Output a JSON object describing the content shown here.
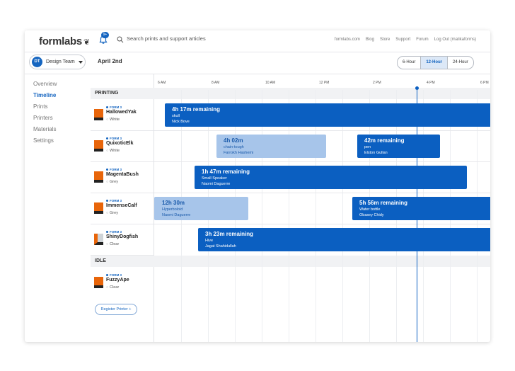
{
  "header": {
    "logo": "formlabs",
    "notification_count": "9+",
    "search_placeholder": "Search prints and support articles",
    "links": [
      "formlabs.com",
      "Blog",
      "Store",
      "Support",
      "Forum",
      "Log Out (malikaforms)"
    ]
  },
  "subbar": {
    "team_initials": "DT",
    "team_name": "Design Team",
    "date": "April 2nd",
    "views": [
      "6-Hour",
      "12-Hour",
      "24-Hour"
    ],
    "active_view": "12-Hour"
  },
  "nav": {
    "items": [
      "Overview",
      "Timeline",
      "Prints",
      "Printers",
      "Materials",
      "Settings"
    ],
    "active": "Timeline"
  },
  "sections": {
    "printing": "PRINTING",
    "idle": "IDLE"
  },
  "printers": [
    {
      "model": "FORM 3",
      "name": "HallowedYak",
      "resin": "White"
    },
    {
      "model": "FORM 3",
      "name": "QuixoticElk",
      "resin": "White"
    },
    {
      "model": "FORM 3",
      "name": "MagentaBush",
      "resin": "Grey"
    },
    {
      "model": "FORM 3",
      "name": "ImmenseCalf",
      "resin": "Grey"
    },
    {
      "model": "FORM 3",
      "name": "ShinyDogfish",
      "resin": "Clear"
    },
    {
      "model": "FORM 3",
      "name": "FuzzyApe",
      "resin": "Clear"
    }
  ],
  "register_button": "Register Printer +",
  "timeline": {
    "ticks": [
      "6 AM",
      "8 AM",
      "10 AM",
      "12 PM",
      "2 PM",
      "4 PM",
      "6 PM"
    ],
    "jobs": [
      {
        "row": 0,
        "title": "4h 17m remaining",
        "part": "skull",
        "owner": "Nick Bove",
        "style": "dark"
      },
      {
        "row": 1,
        "title": "4h 02m",
        "part": "chain-tough",
        "owner": "Farrokh Hashemi",
        "style": "light"
      },
      {
        "row": 1,
        "title": "42m remaining",
        "part": "pen",
        "owner": "Elston Gullan",
        "style": "dark"
      },
      {
        "row": 2,
        "title": "1h 47m remaining",
        "part": "Small Speaker",
        "owner": "Naomi Daguerre",
        "style": "dark"
      },
      {
        "row": 3,
        "title": "12h 30m",
        "part": "Hyperboloid",
        "owner": "Naomi Daguerre",
        "style": "light"
      },
      {
        "row": 3,
        "title": "5h 56m remaining",
        "part": "Water bottle",
        "owner": "Obasey Chidy",
        "style": "dark"
      },
      {
        "row": 4,
        "title": "3h 23m remaining",
        "part": "Hive",
        "owner": "Jagat Shahidullah",
        "style": "dark"
      }
    ]
  },
  "colors": {
    "accent": "#0b5fc1",
    "light_bar": "#a7c5ea",
    "resin_orange": "#e8650a"
  }
}
